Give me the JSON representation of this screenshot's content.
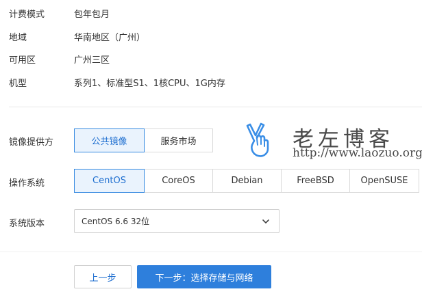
{
  "order_info": [
    {
      "label": "计费模式",
      "value": "包年包月"
    },
    {
      "label": "地域",
      "value": "华南地区（广州）"
    },
    {
      "label": "可用区",
      "value": "广州三区"
    },
    {
      "label": "机型",
      "value": "系列1、标准型S1、1核CPU、1G内存"
    }
  ],
  "image_source": {
    "label": "镜像提供方",
    "options": [
      "公共镜像",
      "服务市场"
    ],
    "selected": "公共镜像"
  },
  "os": {
    "label": "操作系统",
    "options": [
      "CentOS",
      "CoreOS",
      "Debian",
      "FreeBSD",
      "OpenSUSE"
    ],
    "selected": "CentOS"
  },
  "os_version": {
    "label": "系统版本",
    "value": "CentOS 6.6 32位"
  },
  "footer": {
    "prev_label": "上一步",
    "next_label": "下一步：选择存储与网络"
  },
  "watermark": {
    "title": "老左博客",
    "url": "http://www.laozuo.org",
    "icon": "victory-hand-icon"
  },
  "colors": {
    "accent": "#2e7fdc",
    "active_bg": "#eaf3fd",
    "active_border": "#2f86e0",
    "border": "#d9d9d9",
    "watermark_icon": "#3a8ee6"
  }
}
